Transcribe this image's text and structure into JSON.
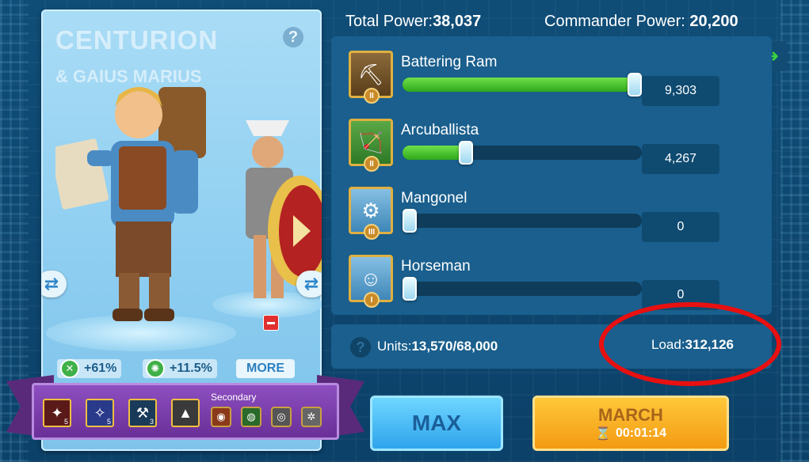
{
  "commander": {
    "title": "CENTURION",
    "subtitle": "& GAIUS MARIUS",
    "help_icon": "?",
    "bonuses": [
      {
        "icon": "attack-icon",
        "value": "+61%"
      },
      {
        "icon": "gear-icon",
        "value": "+11.5%"
      }
    ],
    "more_label": "MORE",
    "secondary_label": "Secondary",
    "skills": [
      {
        "icon": "skill-red-icon",
        "level": "5"
      },
      {
        "icon": "skill-blue-icon",
        "level": "5"
      },
      {
        "icon": "skill-pick-icon",
        "level": "3"
      },
      {
        "icon": "skill-dark-icon",
        "level": ""
      }
    ],
    "secondary_skills": [
      "skill-fire-icon",
      "skill-green-icon",
      "skill-swirl-icon",
      "skill-gear-icon"
    ]
  },
  "header": {
    "total_power_label": "Total Power:",
    "total_power_value": "38,037",
    "commander_power_label": "Commander Power: ",
    "commander_power_value": "20,200"
  },
  "troops": [
    {
      "name": "Battering Ram",
      "count": "9,303",
      "fraction": 1.0,
      "tier": "II"
    },
    {
      "name": "Arcuballista",
      "count": "4,267",
      "fraction": 0.25,
      "tier": "II"
    },
    {
      "name": "Mangonel",
      "count": "0",
      "fraction": 0,
      "tier": "III"
    },
    {
      "name": "Horseman",
      "count": "0",
      "fraction": 0,
      "tier": "I"
    }
  ],
  "summary": {
    "help_icon": "?",
    "units_label": "Units:",
    "units_value": "13,570/68,000",
    "load_label": "Load:",
    "load_value": "312,126"
  },
  "actions": {
    "max_label": "MAX",
    "march_label": "MARCH",
    "march_time": "00:01:14"
  },
  "colors": {
    "highlight": "#e81010",
    "slider_fill": "#2fa81c"
  }
}
